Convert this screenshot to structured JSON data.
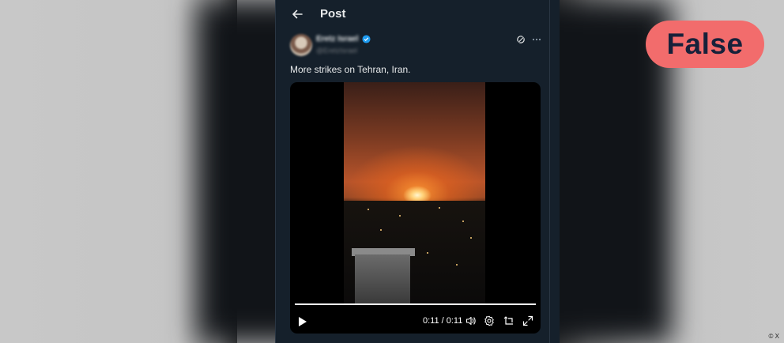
{
  "header": {
    "title": "Post",
    "back": "back-arrow"
  },
  "author": {
    "display_name": "Eretz Israel",
    "handle": "@EretzIsrael",
    "verified": true
  },
  "post": {
    "text": "More strikes on Tehran, Iran."
  },
  "video": {
    "time_display": "0:11 / 0:11",
    "progress_fraction": 1.0,
    "controls": [
      "play-icon",
      "volume-icon",
      "settings-icon",
      "pip-icon",
      "fullscreen-icon"
    ]
  },
  "fact_check": {
    "label": "False",
    "color": "#f26c6c",
    "text_color": "#17213a"
  },
  "credit": "© X",
  "colors": {
    "background": "#15202b",
    "text": "#e7e9ea",
    "muted": "#71767b",
    "verified": "#1d9bf0"
  }
}
